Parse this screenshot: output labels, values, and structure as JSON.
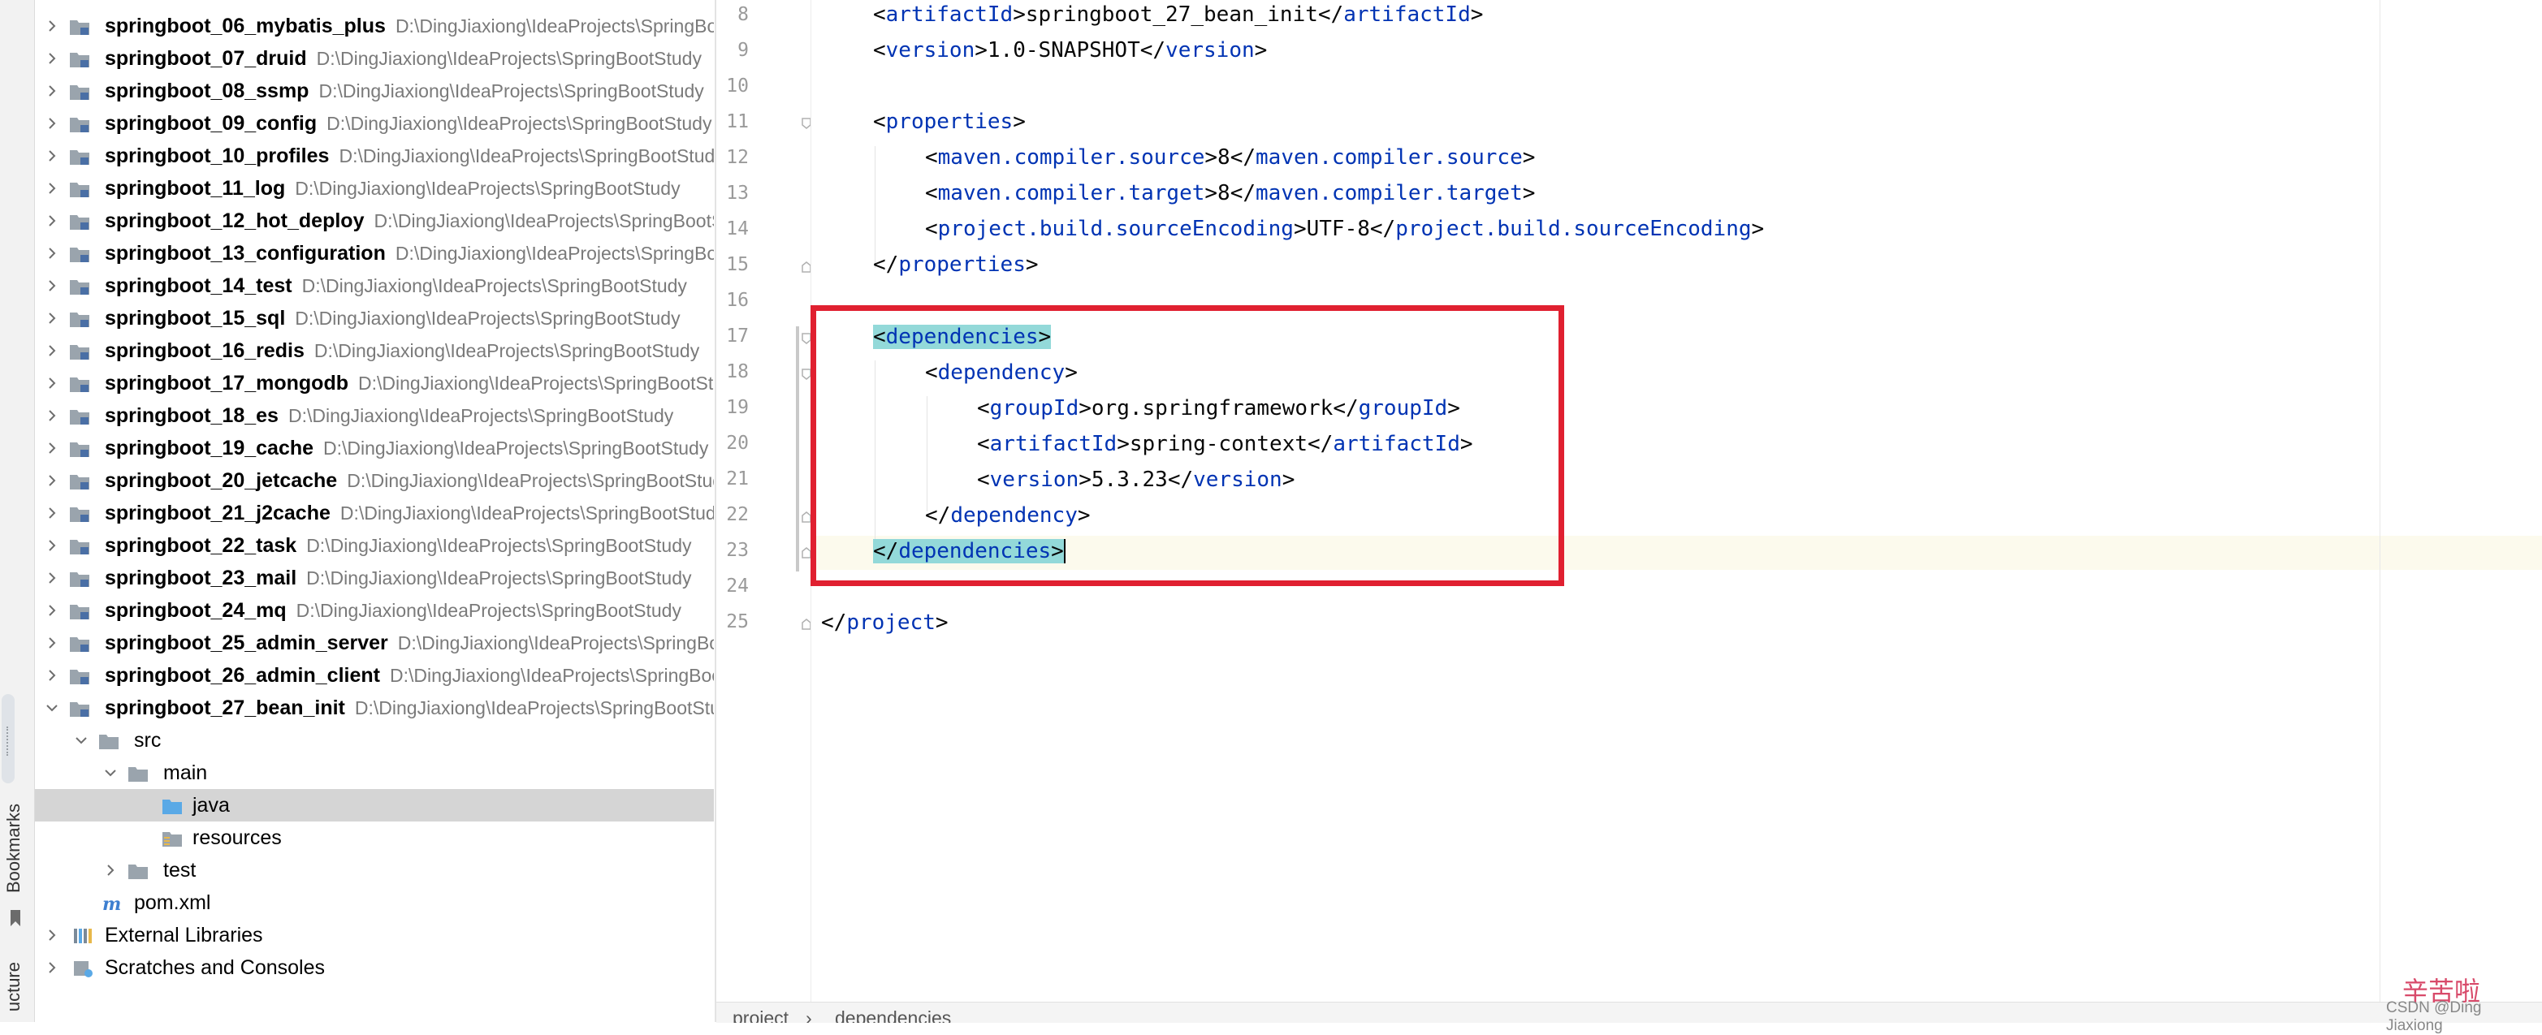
{
  "left_strip": {
    "bookmarks_label": "Bookmarks",
    "structure_label": "ucture"
  },
  "project_tree": {
    "modules": [
      {
        "name": "springboot_06_mybatis_plus",
        "path": "D:\\DingJiaxiong\\IdeaProjects\\SpringBootStudy"
      },
      {
        "name": "springboot_07_druid",
        "path": "D:\\DingJiaxiong\\IdeaProjects\\SpringBootStudy"
      },
      {
        "name": "springboot_08_ssmp",
        "path": "D:\\DingJiaxiong\\IdeaProjects\\SpringBootStudy"
      },
      {
        "name": "springboot_09_config",
        "path": "D:\\DingJiaxiong\\IdeaProjects\\SpringBootStudy"
      },
      {
        "name": "springboot_10_profiles",
        "path": "D:\\DingJiaxiong\\IdeaProjects\\SpringBootStudy"
      },
      {
        "name": "springboot_11_log",
        "path": "D:\\DingJiaxiong\\IdeaProjects\\SpringBootStudy"
      },
      {
        "name": "springboot_12_hot_deploy",
        "path": "D:\\DingJiaxiong\\IdeaProjects\\SpringBootStudy"
      },
      {
        "name": "springboot_13_configuration",
        "path": "D:\\DingJiaxiong\\IdeaProjects\\SpringBootStudy"
      },
      {
        "name": "springboot_14_test",
        "path": "D:\\DingJiaxiong\\IdeaProjects\\SpringBootStudy"
      },
      {
        "name": "springboot_15_sql",
        "path": "D:\\DingJiaxiong\\IdeaProjects\\SpringBootStudy"
      },
      {
        "name": "springboot_16_redis",
        "path": "D:\\DingJiaxiong\\IdeaProjects\\SpringBootStudy"
      },
      {
        "name": "springboot_17_mongodb",
        "path": "D:\\DingJiaxiong\\IdeaProjects\\SpringBootStudy"
      },
      {
        "name": "springboot_18_es",
        "path": "D:\\DingJiaxiong\\IdeaProjects\\SpringBootStudy"
      },
      {
        "name": "springboot_19_cache",
        "path": "D:\\DingJiaxiong\\IdeaProjects\\SpringBootStudy"
      },
      {
        "name": "springboot_20_jetcache",
        "path": "D:\\DingJiaxiong\\IdeaProjects\\SpringBootStudy"
      },
      {
        "name": "springboot_21_j2cache",
        "path": "D:\\DingJiaxiong\\IdeaProjects\\SpringBootStudy"
      },
      {
        "name": "springboot_22_task",
        "path": "D:\\DingJiaxiong\\IdeaProjects\\SpringBootStudy"
      },
      {
        "name": "springboot_23_mail",
        "path": "D:\\DingJiaxiong\\IdeaProjects\\SpringBootStudy"
      },
      {
        "name": "springboot_24_mq",
        "path": "D:\\DingJiaxiong\\IdeaProjects\\SpringBootStudy"
      },
      {
        "name": "springboot_25_admin_server",
        "path": "D:\\DingJiaxiong\\IdeaProjects\\SpringBootStudy"
      },
      {
        "name": "springboot_26_admin_client",
        "path": "D:\\DingJiaxiong\\IdeaProjects\\SpringBootStudy"
      },
      {
        "name": "springboot_27_bean_init",
        "path": "D:\\DingJiaxiong\\IdeaProjects\\SpringBootStudy"
      }
    ],
    "src": "src",
    "main": "main",
    "java": "java",
    "resources": "resources",
    "test": "test",
    "pom": "pom.xml",
    "external_libraries": "External Libraries",
    "scratches": "Scratches and Consoles"
  },
  "editor": {
    "line_numbers": [
      "8",
      "9",
      "10",
      "11",
      "12",
      "13",
      "14",
      "15",
      "16",
      "17",
      "18",
      "19",
      "20",
      "21",
      "22",
      "23",
      "24",
      "25"
    ],
    "code": {
      "artifact_value": "springboot_27_bean_init",
      "version_value": "1.0-SNAPSHOT",
      "source_value": "8",
      "target_value": "8",
      "encoding_value": "UTF-8",
      "group_value": "org.springframework",
      "dep_artifact_value": "spring-context",
      "dep_version_value": "5.3.23"
    },
    "tags": {
      "artifactId": "artifactId",
      "version": "version",
      "properties": "properties",
      "compiler_source": "maven.compiler.source",
      "compiler_target": "maven.compiler.target",
      "source_encoding": "project.build.sourceEncoding",
      "dependencies": "dependencies",
      "dependency": "dependency",
      "groupId": "groupId",
      "project": "project"
    }
  },
  "breadcrumb": {
    "items": [
      "project",
      "dependencies"
    ]
  },
  "watermark": {
    "chinese": "辛苦啦",
    "csdn": "CSDN @Ding Jiaxiong"
  },
  "colors": {
    "tag": "#0033b3",
    "highlight": "#93d9d9",
    "current_line": "#fcfaed",
    "annotation_red": "#e02030",
    "selected_row": "#d5d5d5"
  }
}
